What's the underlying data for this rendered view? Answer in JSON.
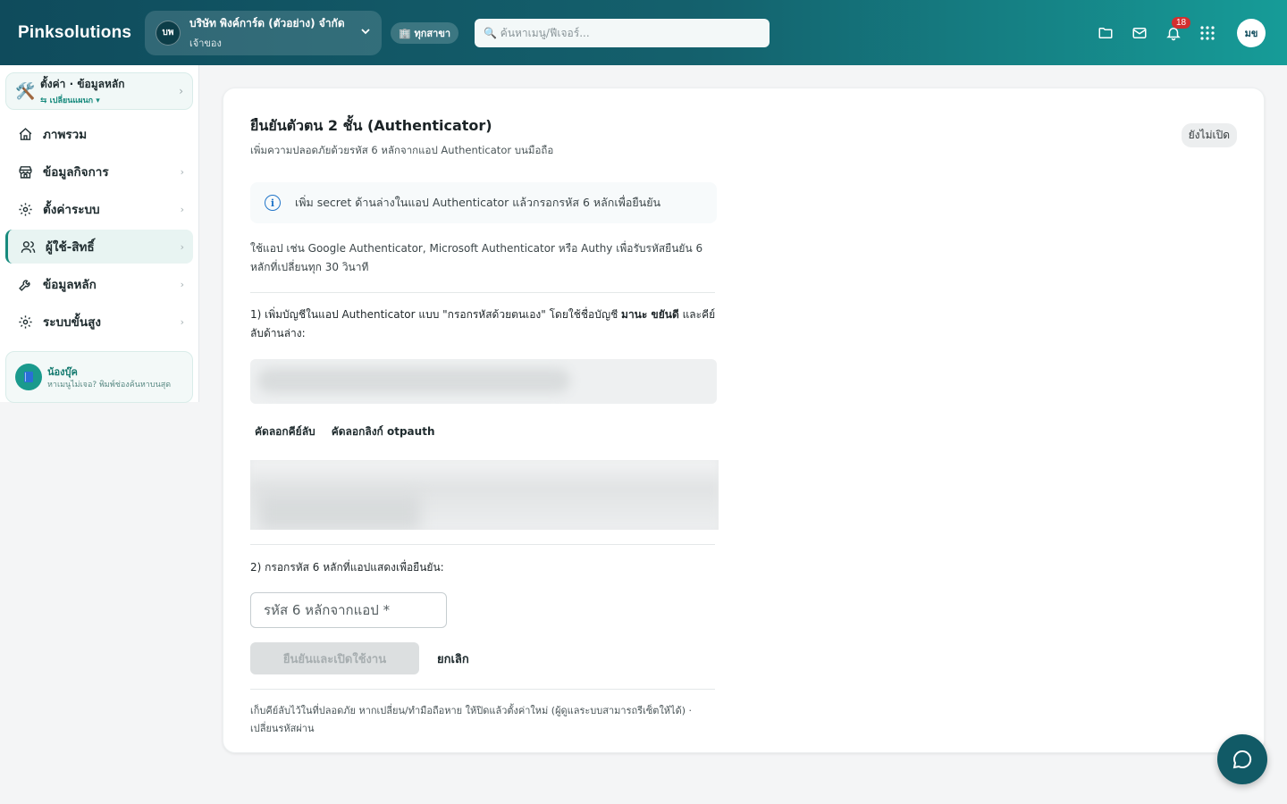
{
  "header": {
    "brand": "Pinksolutions",
    "org": {
      "avatar": "บพ",
      "name": "บริษัท พิงค์การ์ด (ตัวอย่าง) จำกัด",
      "role": "เจ้าของ"
    },
    "branch_label": "🏢 ทุกสาขา",
    "search_placeholder": "🔍 ค้นหาเมนู/ฟีเจอร์...",
    "notification_count": "18",
    "user_initials": "มข",
    "icons": [
      "folder-icon",
      "mail-icon",
      "bell-icon",
      "apps-grid-icon"
    ]
  },
  "sidebar": {
    "head": {
      "icon": "🛠️",
      "title": "ตั้งค่า · ข้อมูลหลัก",
      "sub": "⇆ เปลี่ยนแผนก ▾"
    },
    "items": [
      {
        "label": "ภาพรวม",
        "icon": "home-icon"
      },
      {
        "label": "ข้อมูลกิจการ",
        "icon": "store-icon"
      },
      {
        "label": "ตั้งค่าระบบ",
        "icon": "settings-icon"
      },
      {
        "label": "ผู้ใช้-สิทธิ์",
        "icon": "users-icon"
      },
      {
        "label": "ข้อมูลหลัก",
        "icon": "wrench-icon"
      },
      {
        "label": "ระบบขั้นสูง",
        "icon": "settings-icon"
      }
    ],
    "helper": {
      "title": "น้องบุ๊ค",
      "sub": "หาเมนูไม่เจอ? พิมพ์ช่องค้นหาบนสุด"
    }
  },
  "main": {
    "title": "ยืนยันตัวตน 2 ชั้น (Authenticator)",
    "subtitle": "เพิ่มความปลอดภัยด้วยรหัส 6 หลักจากแอป Authenticator บนมือถือ",
    "status": "ยังไม่เปิด",
    "info": "เพิ่ม secret ด้านล่างในแอป Authenticator แล้วกรอกรหัส 6 หลักเพื่อยืนยัน",
    "description": "ใช้แอป เช่น Google Authenticator, Microsoft Authenticator หรือ Authy เพื่อรับรหัสยืนยัน 6 หลักที่เปลี่ยนทุก 30 วินาที",
    "step1_prefix": "1) เพิ่มบัญชีในแอป Authenticator แบบ \"กรอกรหัสด้วยตนเอง\" โดยใช้ชื่อบัญชี ",
    "step1_account": "มานะ ขยันดี",
    "step1_suffix": " และคีย์ลับด้านล่าง:",
    "copy_secret": "คัดลอกคีย์ลับ",
    "copy_otpauth": "คัดลอกลิงก์ otpauth",
    "step2": "2) กรอกรหัส 6 หลักที่แอปแสดงเพื่อยืนยัน:",
    "code_placeholder": "รหัส 6 หลักจากแอป *",
    "confirm_button": "ยืนยันและเปิดใช้งาน",
    "cancel_button": "ยกเลิก",
    "footnote": "เก็บคีย์ลับไว้ในที่ปลอดภัย หากเปลี่ยน/ทำมือถือหาย ให้ปิดแล้วตั้งค่าใหม่ (ผู้ดูแลระบบสามารถรีเซ็ตให้ได้) · เปลี่ยนรหัสผ่าน"
  }
}
